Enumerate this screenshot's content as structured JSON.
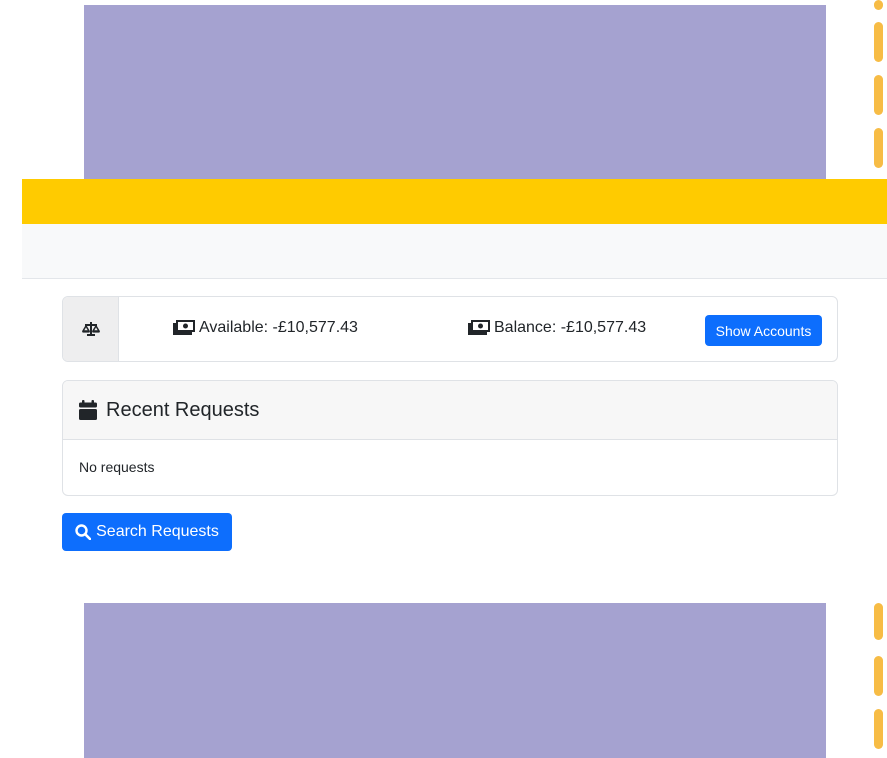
{
  "balance_summary": {
    "available_label": "Available: -£10,577.43",
    "balance_label": "Balance: -£10,577.43",
    "show_accounts_label": "Show Accounts"
  },
  "recent_requests": {
    "title": "Recent Requests",
    "empty_text": "No requests"
  },
  "search_requests_label": "Search Requests",
  "colors": {
    "header_bar": "#ffcb00",
    "placeholder_block": "#a5a2d0",
    "dash_accent": "#f7bc45",
    "primary_button": "#0d6efd"
  },
  "icons": [
    "scale-icon",
    "money-icon",
    "calendar-icon",
    "search-icon"
  ]
}
